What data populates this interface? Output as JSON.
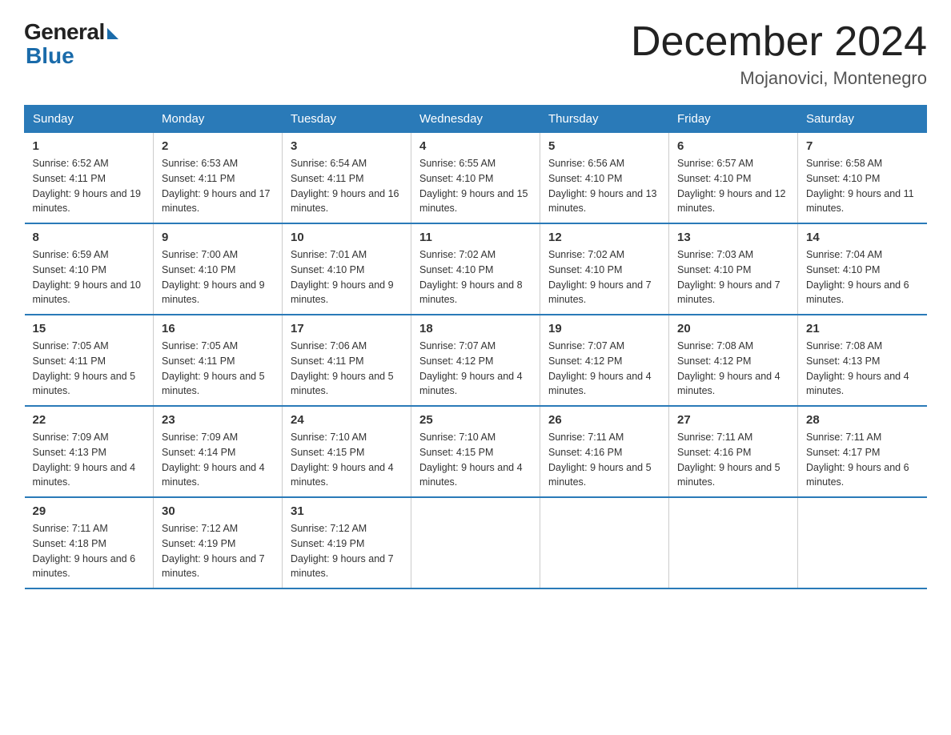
{
  "header": {
    "logo_general": "General",
    "logo_blue": "Blue",
    "month_title": "December 2024",
    "location": "Mojanovici, Montenegro"
  },
  "weekdays": [
    "Sunday",
    "Monday",
    "Tuesday",
    "Wednesday",
    "Thursday",
    "Friday",
    "Saturday"
  ],
  "weeks": [
    [
      {
        "day": "1",
        "sunrise": "6:52 AM",
        "sunset": "4:11 PM",
        "daylight": "9 hours and 19 minutes."
      },
      {
        "day": "2",
        "sunrise": "6:53 AM",
        "sunset": "4:11 PM",
        "daylight": "9 hours and 17 minutes."
      },
      {
        "day": "3",
        "sunrise": "6:54 AM",
        "sunset": "4:11 PM",
        "daylight": "9 hours and 16 minutes."
      },
      {
        "day": "4",
        "sunrise": "6:55 AM",
        "sunset": "4:10 PM",
        "daylight": "9 hours and 15 minutes."
      },
      {
        "day": "5",
        "sunrise": "6:56 AM",
        "sunset": "4:10 PM",
        "daylight": "9 hours and 13 minutes."
      },
      {
        "day": "6",
        "sunrise": "6:57 AM",
        "sunset": "4:10 PM",
        "daylight": "9 hours and 12 minutes."
      },
      {
        "day": "7",
        "sunrise": "6:58 AM",
        "sunset": "4:10 PM",
        "daylight": "9 hours and 11 minutes."
      }
    ],
    [
      {
        "day": "8",
        "sunrise": "6:59 AM",
        "sunset": "4:10 PM",
        "daylight": "9 hours and 10 minutes."
      },
      {
        "day": "9",
        "sunrise": "7:00 AM",
        "sunset": "4:10 PM",
        "daylight": "9 hours and 9 minutes."
      },
      {
        "day": "10",
        "sunrise": "7:01 AM",
        "sunset": "4:10 PM",
        "daylight": "9 hours and 9 minutes."
      },
      {
        "day": "11",
        "sunrise": "7:02 AM",
        "sunset": "4:10 PM",
        "daylight": "9 hours and 8 minutes."
      },
      {
        "day": "12",
        "sunrise": "7:02 AM",
        "sunset": "4:10 PM",
        "daylight": "9 hours and 7 minutes."
      },
      {
        "day": "13",
        "sunrise": "7:03 AM",
        "sunset": "4:10 PM",
        "daylight": "9 hours and 7 minutes."
      },
      {
        "day": "14",
        "sunrise": "7:04 AM",
        "sunset": "4:10 PM",
        "daylight": "9 hours and 6 minutes."
      }
    ],
    [
      {
        "day": "15",
        "sunrise": "7:05 AM",
        "sunset": "4:11 PM",
        "daylight": "9 hours and 5 minutes."
      },
      {
        "day": "16",
        "sunrise": "7:05 AM",
        "sunset": "4:11 PM",
        "daylight": "9 hours and 5 minutes."
      },
      {
        "day": "17",
        "sunrise": "7:06 AM",
        "sunset": "4:11 PM",
        "daylight": "9 hours and 5 minutes."
      },
      {
        "day": "18",
        "sunrise": "7:07 AM",
        "sunset": "4:12 PM",
        "daylight": "9 hours and 4 minutes."
      },
      {
        "day": "19",
        "sunrise": "7:07 AM",
        "sunset": "4:12 PM",
        "daylight": "9 hours and 4 minutes."
      },
      {
        "day": "20",
        "sunrise": "7:08 AM",
        "sunset": "4:12 PM",
        "daylight": "9 hours and 4 minutes."
      },
      {
        "day": "21",
        "sunrise": "7:08 AM",
        "sunset": "4:13 PM",
        "daylight": "9 hours and 4 minutes."
      }
    ],
    [
      {
        "day": "22",
        "sunrise": "7:09 AM",
        "sunset": "4:13 PM",
        "daylight": "9 hours and 4 minutes."
      },
      {
        "day": "23",
        "sunrise": "7:09 AM",
        "sunset": "4:14 PM",
        "daylight": "9 hours and 4 minutes."
      },
      {
        "day": "24",
        "sunrise": "7:10 AM",
        "sunset": "4:15 PM",
        "daylight": "9 hours and 4 minutes."
      },
      {
        "day": "25",
        "sunrise": "7:10 AM",
        "sunset": "4:15 PM",
        "daylight": "9 hours and 4 minutes."
      },
      {
        "day": "26",
        "sunrise": "7:11 AM",
        "sunset": "4:16 PM",
        "daylight": "9 hours and 5 minutes."
      },
      {
        "day": "27",
        "sunrise": "7:11 AM",
        "sunset": "4:16 PM",
        "daylight": "9 hours and 5 minutes."
      },
      {
        "day": "28",
        "sunrise": "7:11 AM",
        "sunset": "4:17 PM",
        "daylight": "9 hours and 6 minutes."
      }
    ],
    [
      {
        "day": "29",
        "sunrise": "7:11 AM",
        "sunset": "4:18 PM",
        "daylight": "9 hours and 6 minutes."
      },
      {
        "day": "30",
        "sunrise": "7:12 AM",
        "sunset": "4:19 PM",
        "daylight": "9 hours and 7 minutes."
      },
      {
        "day": "31",
        "sunrise": "7:12 AM",
        "sunset": "4:19 PM",
        "daylight": "9 hours and 7 minutes."
      },
      null,
      null,
      null,
      null
    ]
  ]
}
